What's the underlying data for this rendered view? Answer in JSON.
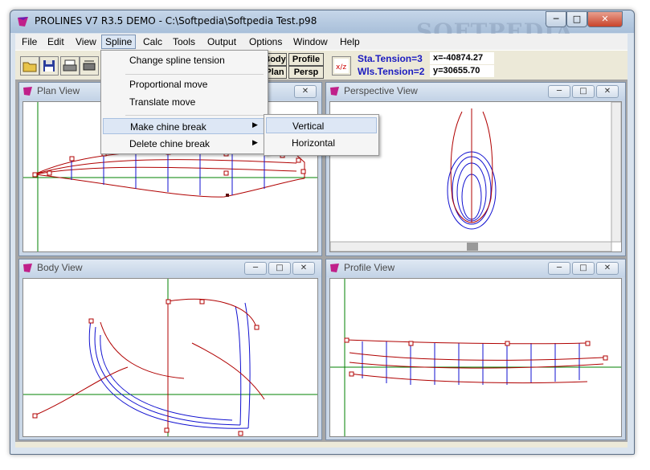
{
  "window": {
    "title": "PROLINES V7 R3.5 DEMO - C:\\Softpedia\\Softpedia Test.p98",
    "minimize": "─",
    "maximize": "□",
    "close": "✕",
    "watermark": "SOFTPEDIA"
  },
  "menubar": {
    "items": [
      "File",
      "Edit",
      "View",
      "Spline",
      "Calc",
      "Tools",
      "Output",
      "Options",
      "Window",
      "Help"
    ]
  },
  "toolbar": {
    "icons": [
      "open-folder-icon",
      "save-disk-icon",
      "print-icon",
      "printer-setup-icon"
    ],
    "view_buttons": {
      "body": "Body",
      "profile": "Profile",
      "plan": "Plan",
      "persp": "Persp"
    },
    "tension_icon": "tension-icon",
    "sta_tension": "Sta.Tension=3",
    "wls_tension": "Wls.Tension=2",
    "x_coord": "x=-40874.27",
    "y_coord": "y=30655.70"
  },
  "views": {
    "plan": {
      "title": "Plan View"
    },
    "perspective": {
      "title": "Perspective View"
    },
    "body": {
      "title": "Body View"
    },
    "profile": {
      "title": "Profile View"
    },
    "btn_min": "─",
    "btn_max": "□",
    "btn_close": "✕"
  },
  "spline_menu": {
    "items": [
      "Change spline tension",
      "Proportional move",
      "Translate move",
      "Make chine break",
      "Delete chine break"
    ],
    "submenu_arrow": "▶",
    "submenu": [
      "Vertical",
      "Horizontal"
    ]
  },
  "colors": {
    "hull_red": "#b00000",
    "hull_blue": "#1010d0",
    "axis_green": "#008000",
    "menu_highlight": "#dde7f5"
  }
}
